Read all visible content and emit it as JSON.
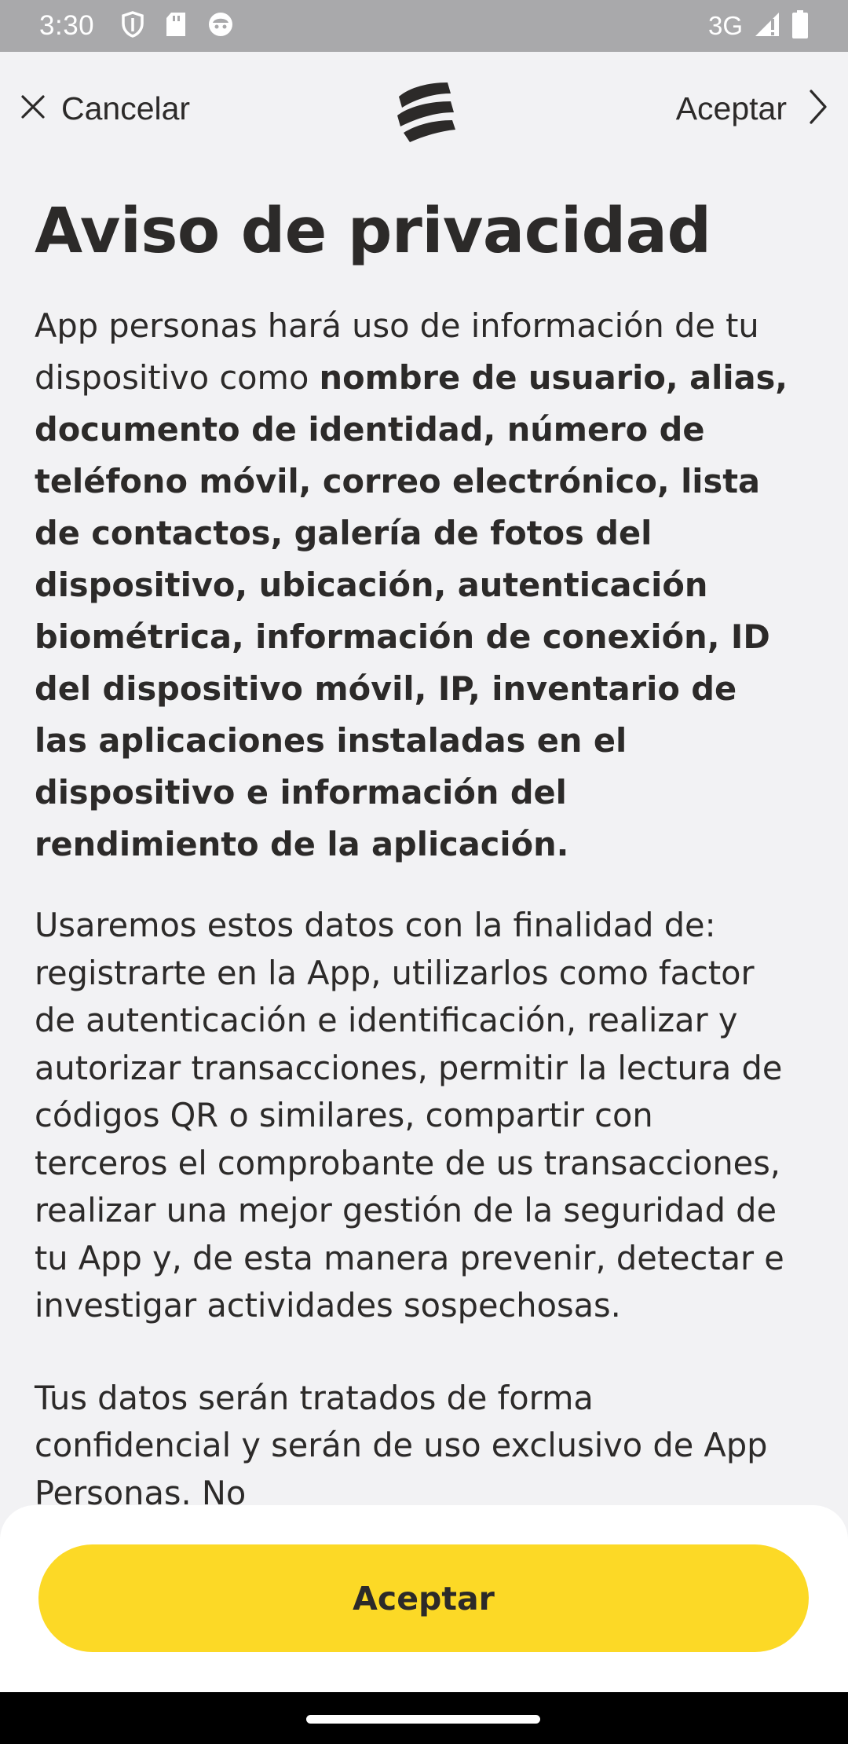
{
  "status_bar": {
    "time": "3:30",
    "network": "3G",
    "icons": [
      "shield-icon",
      "sd-card-icon",
      "notification-face-icon",
      "signal-icon",
      "battery-icon"
    ]
  },
  "header": {
    "cancel_label": "Cancelar",
    "accept_label": "Aceptar",
    "logo": "brand-logo"
  },
  "content": {
    "title": "Aviso de privacidad",
    "p1_intro": "App personas hará uso de información de tu dispositivo como ",
    "p1_bold": "nombre de usuario, alias, documento de identidad, número de teléfono móvil, correo electrónico, lista de contactos, galería de fotos del dispositivo, ubicación, autenticación biométrica, información de conexión, ID del dispositivo móvil, IP, inventario de las aplicaciones instaladas en el dispositivo e información del rendimiento de la aplicación.",
    "p2": "Usaremos estos datos con la finalidad de: registrarte en la App, utilizarlos como factor de autenticación e identificación, realizar y autorizar transacciones, permitir la lectura de códigos QR o similares, compartir con terceros el comprobante de us transacciones, realizar una mejor gestión de la seguridad de tu App y, de esta manera prevenir, detectar e investigar actividades sospechosas.",
    "p3": "Tus datos serán tratados de forma confidencial y serán de uso exclusivo de App Personas. No"
  },
  "footer": {
    "accept_button": "Aceptar"
  },
  "colors": {
    "accent": "#fcd926",
    "text": "#2c2a29",
    "background": "#f2f2f4",
    "status_bar": "#a9a9ab"
  }
}
